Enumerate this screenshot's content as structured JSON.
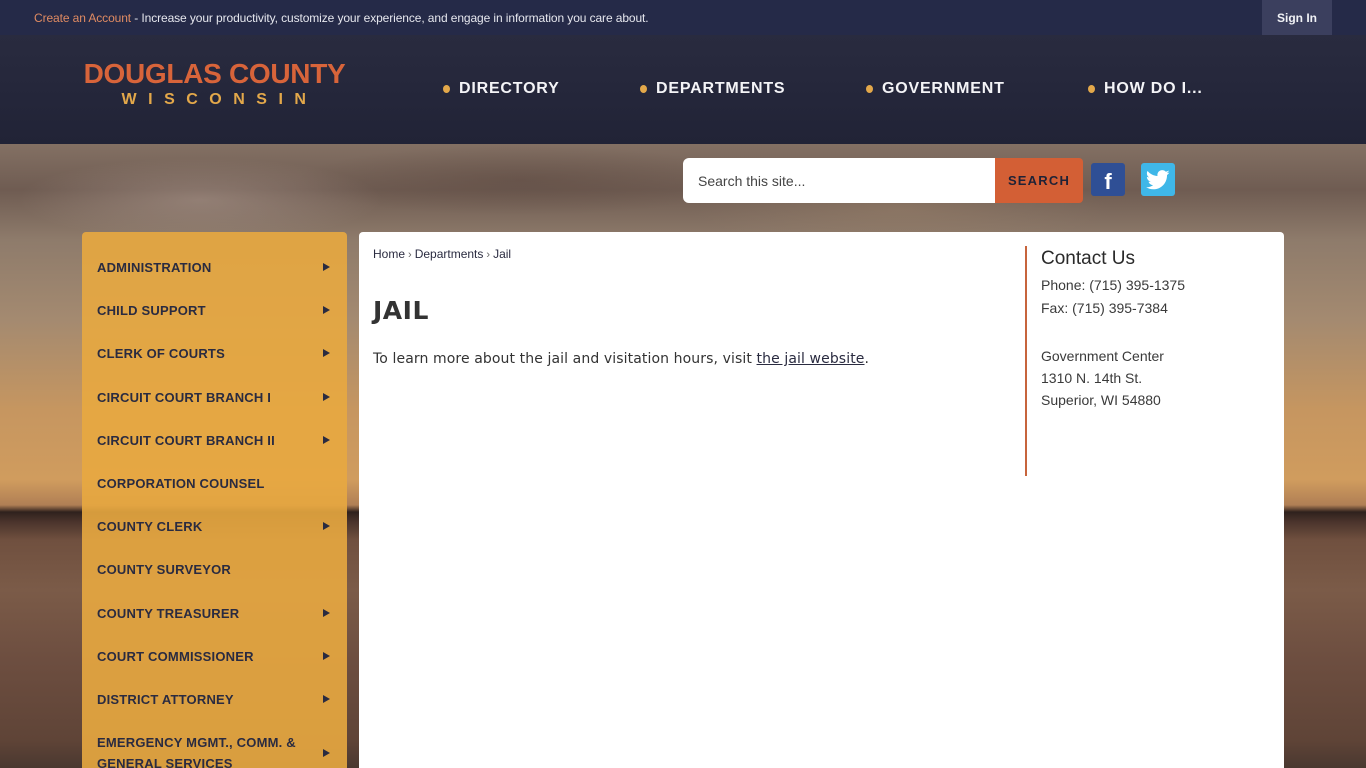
{
  "topbar": {
    "create_account": "Create an Account",
    "promo_text": " - Increase your productivity, customize your experience, and engage in information you care about.",
    "sign_in": "Sign In"
  },
  "logo": {
    "name": "DOUGLAS COUNTY",
    "state": "WISCONSIN"
  },
  "nav": {
    "items": [
      {
        "label": "DIRECTORY"
      },
      {
        "label": "DEPARTMENTS"
      },
      {
        "label": "GOVERNMENT"
      },
      {
        "label": "HOW DO I..."
      }
    ]
  },
  "search": {
    "placeholder": "Search this site...",
    "button": "SEARCH"
  },
  "social": {
    "facebook": "f",
    "twitter_icon": "twitter-bird"
  },
  "sidebar": {
    "items": [
      {
        "label": "ADMINISTRATION",
        "has_submenu": true
      },
      {
        "label": "CHILD SUPPORT",
        "has_submenu": true
      },
      {
        "label": "CLERK OF COURTS",
        "has_submenu": true
      },
      {
        "label": "CIRCUIT COURT BRANCH I",
        "has_submenu": true
      },
      {
        "label": "CIRCUIT COURT BRANCH II",
        "has_submenu": true
      },
      {
        "label": "CORPORATION COUNSEL",
        "has_submenu": false
      },
      {
        "label": "COUNTY CLERK",
        "has_submenu": true
      },
      {
        "label": "COUNTY SURVEYOR",
        "has_submenu": false
      },
      {
        "label": "COUNTY TREASURER",
        "has_submenu": true
      },
      {
        "label": "COURT COMMISSIONER",
        "has_submenu": true
      },
      {
        "label": "DISTRICT ATTORNEY",
        "has_submenu": true
      },
      {
        "label": "EMERGENCY MGMT., COMM. & GENERAL SERVICES",
        "has_submenu": true
      }
    ]
  },
  "breadcrumb": {
    "home": "Home",
    "departments": "Departments",
    "current": "Jail",
    "separator": "›"
  },
  "main": {
    "title": "JAIL",
    "text_before": "To learn more about the jail and visitation hours, visit ",
    "link_text": "the jail website",
    "text_after": "."
  },
  "contact": {
    "heading": "Contact Us",
    "phone": "Phone: (715) 395-1375",
    "fax": "Fax: (715) 395-7384",
    "address_line1": "Government Center",
    "address_line2": "1310 N. 14th St.",
    "address_line3": "Superior, WI 54880"
  },
  "colors": {
    "topbar_bg": "#252a48",
    "accent_orange": "#d8643a",
    "accent_gold": "#e3a84a",
    "search_button": "#d35f35",
    "facebook": "#2f4f95",
    "twitter": "#3fb7e8",
    "sidebar_bg": "#e8a840",
    "text_dark": "#2a2b40"
  }
}
